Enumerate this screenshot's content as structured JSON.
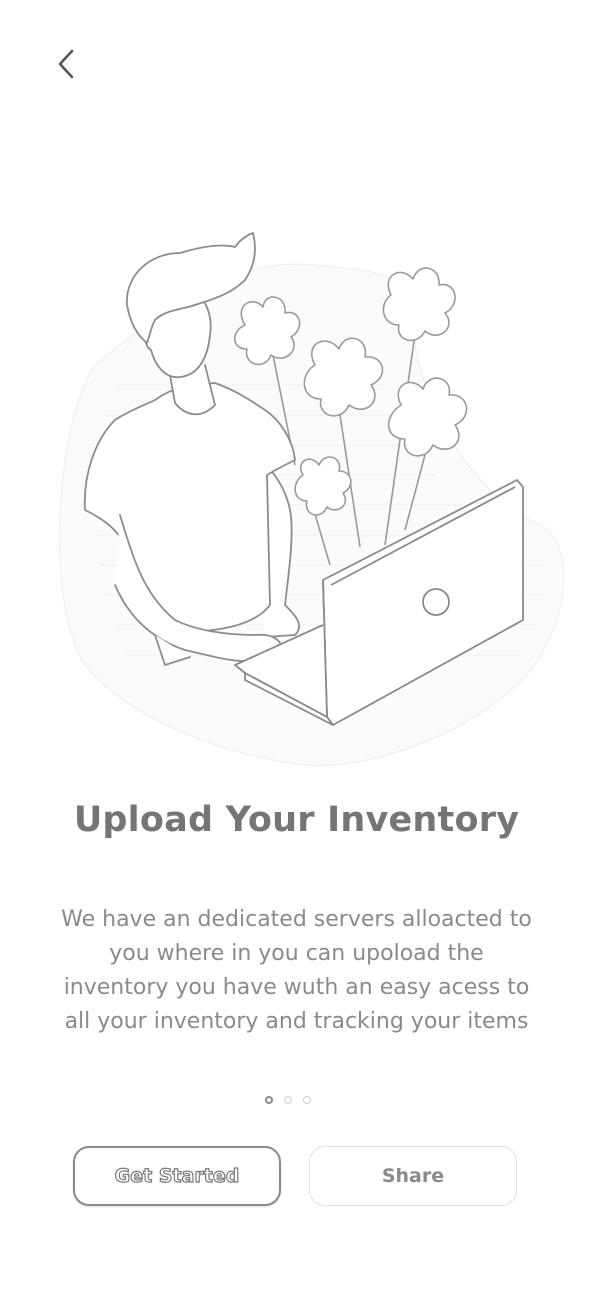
{
  "header": {
    "back_icon": "chevron-left-icon"
  },
  "illustration": {
    "subject": "person-working-on-laptop-illustration"
  },
  "onboarding": {
    "title": "Upload Your Inventory",
    "description": "We have an dedicated servers alloacted to you where in you can upoload the inventory you have wuth an easy acess to all your inventory and tracking your items",
    "page_count": 3,
    "active_page": 1
  },
  "actions": {
    "get_started_label": "Get Started",
    "share_label": "Share"
  },
  "colors": {
    "text": "#757575",
    "muted": "#8a8a8a",
    "border_light": "#e2e2e2",
    "background": "#ffffff"
  }
}
